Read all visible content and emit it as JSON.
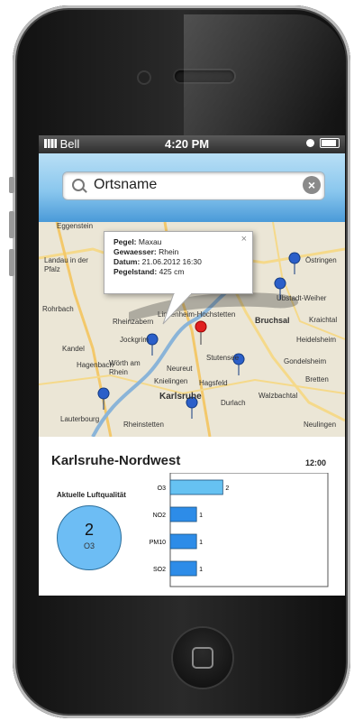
{
  "statusbar": {
    "carrier": "Bell",
    "time": "4:20 PM"
  },
  "search": {
    "value": "Ortsname"
  },
  "map": {
    "labels": [
      "Eggenstein",
      "Landau in der Pfalz",
      "Rohrbach",
      "Rheinzabern",
      "Jockgrim",
      "Kandel",
      "Hagenbach",
      "Wörth am Rhein",
      "Neureut",
      "Knielingen",
      "Karlsruhe",
      "Stutensee",
      "Hagsfeld",
      "Durlach",
      "Bruchsal",
      "Kraichtal",
      "Östringen",
      "Ubstadt-Weiher",
      "Heidelsheim",
      "Gondelsheim",
      "Bretten",
      "Walzbachtal",
      "Neulingen",
      "Rheinstetten",
      "Lauterbourg",
      "Linkenheim-Hochstetten"
    ],
    "popup": {
      "pegel_key": "Pegel:",
      "pegel_val": "Maxau",
      "gewaesser_key": "Gewaesser:",
      "gewaesser_val": "Rhein",
      "datum_key": "Datum:",
      "datum_val": "21.06.2012 16:30",
      "pegelstand_key": "Pegelstand:",
      "pegelstand_val": "425 cm",
      "close": "×"
    }
  },
  "station": {
    "name": "Karlsruhe-Nordwest",
    "time": "12:00"
  },
  "air_quality": {
    "label": "Aktuelle Luftqualität",
    "value": "2",
    "pollutant": "O3"
  },
  "colors": {
    "bar_light": "#66c2f2",
    "bar_dark": "#2d8ce8",
    "circle": "#6dbdf4",
    "header": "#4a9ad8"
  },
  "chart_data": {
    "type": "bar",
    "orientation": "horizontal",
    "categories": [
      "O3",
      "NO2",
      "PM10",
      "SO2"
    ],
    "values": [
      2,
      1,
      1,
      1
    ],
    "xlim": [
      0,
      6
    ],
    "data_labels": true,
    "title": ""
  }
}
